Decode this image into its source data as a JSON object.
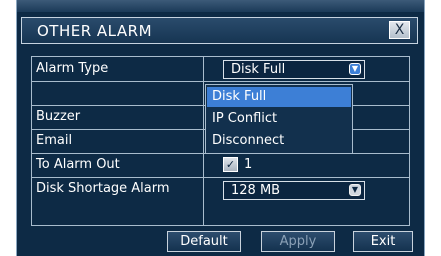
{
  "dialog": {
    "title": "OTHER ALARM",
    "close_label": "X"
  },
  "form": {
    "alarm_type_label": "Alarm Type",
    "alarm_type_value": "Disk Full",
    "buzzer_label": "Buzzer",
    "email_label": "Email",
    "to_alarm_out_label": "To Alarm Out",
    "to_alarm_out_value": "1",
    "disk_shortage_label": "Disk Shortage Alarm",
    "disk_shortage_value": "128 MB"
  },
  "dropdown": {
    "options": [
      "Disk Full",
      "IP Conflict",
      "Disconnect"
    ],
    "selected_index": 0
  },
  "buttons": {
    "default": "Default",
    "apply": "Apply",
    "exit": "Exit"
  },
  "colors": {
    "background": "#0d2a45",
    "highlight": "#3d7fd6",
    "border": "#a8bccd"
  }
}
